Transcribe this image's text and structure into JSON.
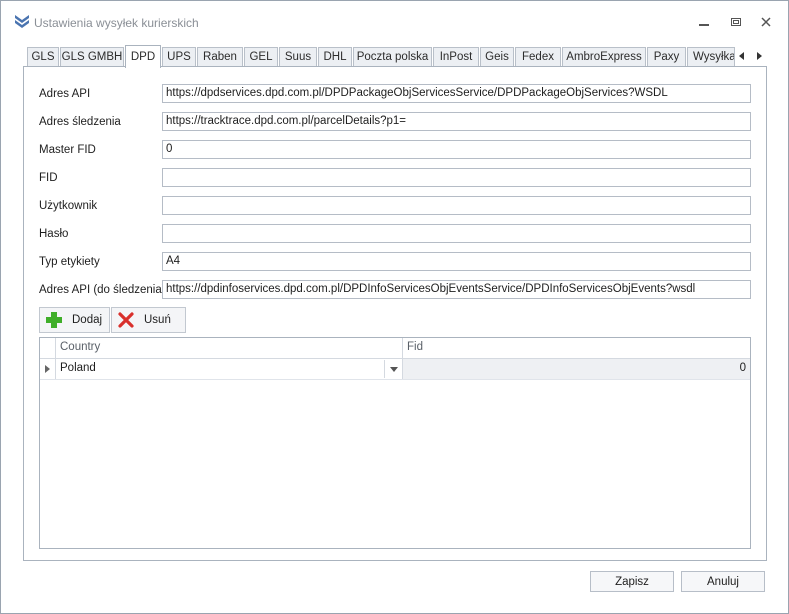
{
  "window": {
    "title": "Ustawienia wysyłek kurierskich"
  },
  "tabs": [
    "GLS",
    "GLS GMBH",
    "DPD",
    "UPS",
    "Raben",
    "GEL",
    "Suus",
    "DHL",
    "Poczta polska",
    "InPost",
    "Geis",
    "Fedex",
    "AmbroExpress",
    "Paxy",
    "Wysyłka"
  ],
  "active_tab": "DPD",
  "form": {
    "api_url": {
      "label": "Adres API",
      "value": "https://dpdservices.dpd.com.pl/DPDPackageObjServicesService/DPDPackageObjServices?WSDL"
    },
    "tracking_url": {
      "label": "Adres śledzenia",
      "value": "https://tracktrace.dpd.com.pl/parcelDetails?p1="
    },
    "master_fid": {
      "label": "Master FID",
      "value": "0"
    },
    "fid": {
      "label": "FID",
      "value": ""
    },
    "user": {
      "label": "Użytkownik",
      "value": ""
    },
    "password": {
      "label": "Hasło",
      "value": ""
    },
    "label_type": {
      "label": "Typ etykiety",
      "value": "A4"
    },
    "tracking_api_url": {
      "label": "Adres API (do śledzenia)",
      "value": "https://dpdinfoservices.dpd.com.pl/DPDInfoServicesObjEventsService/DPDInfoServicesObjEvents?wsdl"
    }
  },
  "toolbar": {
    "add_label": "Dodaj",
    "remove_label": "Usuń"
  },
  "grid": {
    "columns": [
      "Country",
      "Fid"
    ],
    "rows": [
      {
        "country": "Poland",
        "fid": "0"
      }
    ]
  },
  "buttons": {
    "save": "Zapisz",
    "cancel": "Anuluj"
  },
  "colors": {
    "accent_blue": "#4a74b0",
    "add_green": "#3fae29",
    "remove_red": "#d9302c"
  }
}
